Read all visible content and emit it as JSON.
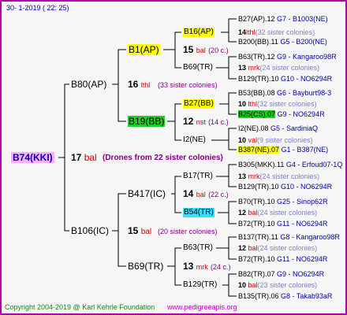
{
  "header": {
    "date": "30-   1-2019  (  22:  25)"
  },
  "footer": {
    "copyright": "Copyright 2004-2019 @ Karl Kehrle Foundation",
    "site": "www.pedigreeapis.org"
  },
  "root": {
    "name": "B74(KKI)",
    "num": "17",
    "unit": "bal",
    "note": "(Drones from 22 sister colonies)"
  },
  "gen1": {
    "father": {
      "name": "B80(AP)",
      "num": "16",
      "unit": "lthl",
      "note": "(33 sister colonies)"
    },
    "mother": {
      "name": "B106(IC)",
      "num": "15",
      "unit": "bal",
      "note": "(20 sister colonies)"
    }
  },
  "gen2": {
    "b1": {
      "name": "B1(AP)",
      "num": "15",
      "unit": "bal",
      "note": "(20 c.)"
    },
    "b19": {
      "name": "B19(BB)",
      "num": "12",
      "unit": "nst",
      "note": "(14 c.)"
    },
    "b417": {
      "name": "B417(IC)",
      "num": "14",
      "unit": "bal",
      "note": "(22 c.)"
    },
    "b69": {
      "name": "B69(TR)",
      "num": "13",
      "unit": "mrk",
      "note": "(24 c.)"
    }
  },
  "gen3": {
    "b16": {
      "name": "B16(AP)",
      "num": "14",
      "unit": "lthl",
      "note": "(32 sister colonies)"
    },
    "b69tr": {
      "name": "B69(TR)",
      "num": "13",
      "unit": "mrk",
      "note": "(24 sister colonies)"
    },
    "b27": {
      "name": "B27(BB)",
      "num": "10",
      "unit": "lthl",
      "note": "(32 sister colonies)"
    },
    "i2": {
      "name": "I2(NE)",
      "num": "10",
      "unit": "val",
      "note": "(9 sister colonies)"
    },
    "b17": {
      "name": "B17(TR)",
      "num": "13",
      "unit": "mrk",
      "note": "(24 sister colonies)"
    },
    "b54": {
      "name": "B54(TR)",
      "num": "12",
      "unit": "bal",
      "note": "(24 sister colonies)"
    },
    "b63": {
      "name": "B63(TR)",
      "num": "12",
      "unit": "bal",
      "note": "(24 sister colonies)"
    },
    "b129": {
      "name": "B129(TR)",
      "num": "10",
      "unit": "bal",
      "note": "(23 sister colonies)"
    }
  },
  "gen4": [
    {
      "name": "B27(AP).12",
      "info": "G7 - B1003(NE)"
    },
    {
      "name": "B200(BB).11",
      "info": "G5 - B200(NE)"
    },
    {
      "name": "B63(TR).12",
      "info": "G9 - Kangaroo98R"
    },
    {
      "name": "B129(TR).10",
      "info": "G10 - NO6294R"
    },
    {
      "name": "B53(BB).08",
      "info": "G6 - Bayburt98-3"
    },
    {
      "name": "B25(CS).07",
      "info": "G9 - NO6294R"
    },
    {
      "name": "I2(NE).08",
      "info": "G5 - SardiniaQ"
    },
    {
      "name": "B387(NE).07",
      "info": "G1 - B387(NE)"
    },
    {
      "name": "B305(MKK).11",
      "info": "G4 - Erfoud07-1Q"
    },
    {
      "name": "B129(TR).10",
      "info": "G10 - NO6294R"
    },
    {
      "name": "B70(TR).10",
      "info": "G25 - Sinop62R"
    },
    {
      "name": "B72(TR).10",
      "info": "G11 - NO6294R"
    },
    {
      "name": "B137(TR).11",
      "info": "G8 - Kangaroo98R"
    },
    {
      "name": "B72(TR).10",
      "info": "G11 - NO6294R"
    },
    {
      "name": "B82(TR).07",
      "info": "G9 - NO6294R"
    },
    {
      "name": "B135(TR).06",
      "info": "G8 - Takab93aR"
    }
  ]
}
